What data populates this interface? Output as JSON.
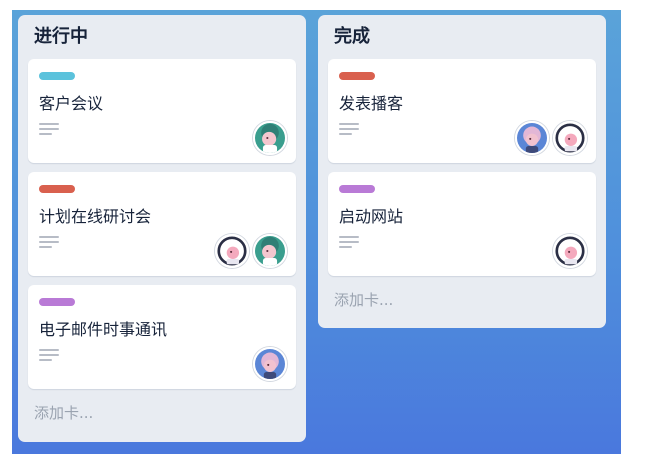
{
  "lists": [
    {
      "title": "进行中",
      "add_card": "添加卡...",
      "cards": [
        {
          "title": "客户会议",
          "label_color": "#5bc2dc",
          "avatars": [
            "green"
          ]
        },
        {
          "title": "计划在线研讨会",
          "label_color": "#d9604e",
          "avatars": [
            "white",
            "green"
          ]
        },
        {
          "title": "电子邮件时事通讯",
          "label_color": "#b97ad6",
          "avatars": [
            "blue"
          ]
        }
      ]
    },
    {
      "title": "完成",
      "add_card": "添加卡...",
      "cards": [
        {
          "title": "发表播客",
          "label_color": "#d9604e",
          "avatars": [
            "blue",
            "white"
          ]
        },
        {
          "title": "启动网站",
          "label_color": "#b97ad6",
          "avatars": [
            "white"
          ]
        }
      ]
    }
  ],
  "icons": {
    "description": "description-lines-icon",
    "avatar": "member-avatar-icon"
  },
  "colors": {
    "board_top": "#5aa3d9",
    "board_bottom": "#4a78dd",
    "list_bg": "#e8ecf2",
    "card_bg": "#ffffff",
    "title_text": "#17233a",
    "add_text": "#9aa3b0"
  }
}
